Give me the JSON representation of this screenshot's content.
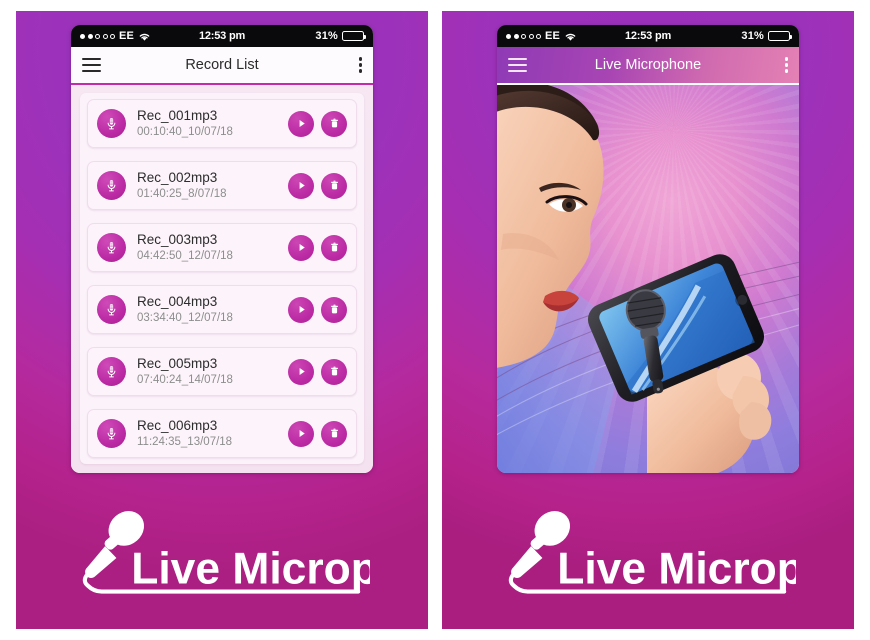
{
  "brand": {
    "name": "Live Microphone",
    "logo_icon": "microphone-icon"
  },
  "status_bar": {
    "signal_icon": "signal-dots-icon",
    "signal_bars_filled": 2,
    "signal_bars_total": 5,
    "carrier": "EE",
    "wifi_icon": "wifi-icon",
    "time": "12:53 pm",
    "battery_percent": "31%",
    "battery_level": 31,
    "battery_icon": "battery-icon"
  },
  "panels": [
    {
      "id": "record-list-panel",
      "app_bar": {
        "menu_icon": "hamburger-menu-icon",
        "title": "Record List",
        "overflow_icon": "overflow-menu-icon",
        "style": "light"
      },
      "records": [
        {
          "name": "Rec_001mp3",
          "time": "00:10:40_10/07/18",
          "mic_icon": "microphone-icon",
          "play_icon": "play-icon",
          "delete_icon": "trash-icon"
        },
        {
          "name": "Rec_002mp3",
          "time": "01:40:25_8/07/18",
          "mic_icon": "microphone-icon",
          "play_icon": "play-icon",
          "delete_icon": "trash-icon"
        },
        {
          "name": "Rec_003mp3",
          "time": "04:42:50_12/07/18",
          "mic_icon": "microphone-icon",
          "play_icon": "play-icon",
          "delete_icon": "trash-icon"
        },
        {
          "name": "Rec_004mp3",
          "time": "03:34:40_12/07/18",
          "mic_icon": "microphone-icon",
          "play_icon": "play-icon",
          "delete_icon": "trash-icon"
        },
        {
          "name": "Rec_005mp3",
          "time": "07:40:24_14/07/18",
          "mic_icon": "microphone-icon",
          "play_icon": "play-icon",
          "delete_icon": "trash-icon"
        },
        {
          "name": "Rec_006mp3",
          "time": "11:24:35_13/07/18",
          "mic_icon": "microphone-icon",
          "play_icon": "play-icon",
          "delete_icon": "trash-icon"
        }
      ]
    },
    {
      "id": "live-microphone-panel",
      "app_bar": {
        "menu_icon": "hamburger-menu-icon",
        "title": "Live Microphone",
        "overflow_icon": "overflow-menu-icon",
        "style": "gradient"
      },
      "artwork": {
        "description": "woman-singing-into-phone-photo",
        "device_screen_icon": "microphone-icon"
      }
    }
  ],
  "colors": {
    "background_purple": "#9c32bb",
    "background_magenta": "#b4228c",
    "accent_magenta": "#bb2aa4",
    "app_bar_light": "#fdfbfd",
    "row_background": "#fcf4fa",
    "text_primary": "#2c2c2c",
    "text_secondary": "#8d8d8d",
    "brand_text": "#ffffff"
  }
}
